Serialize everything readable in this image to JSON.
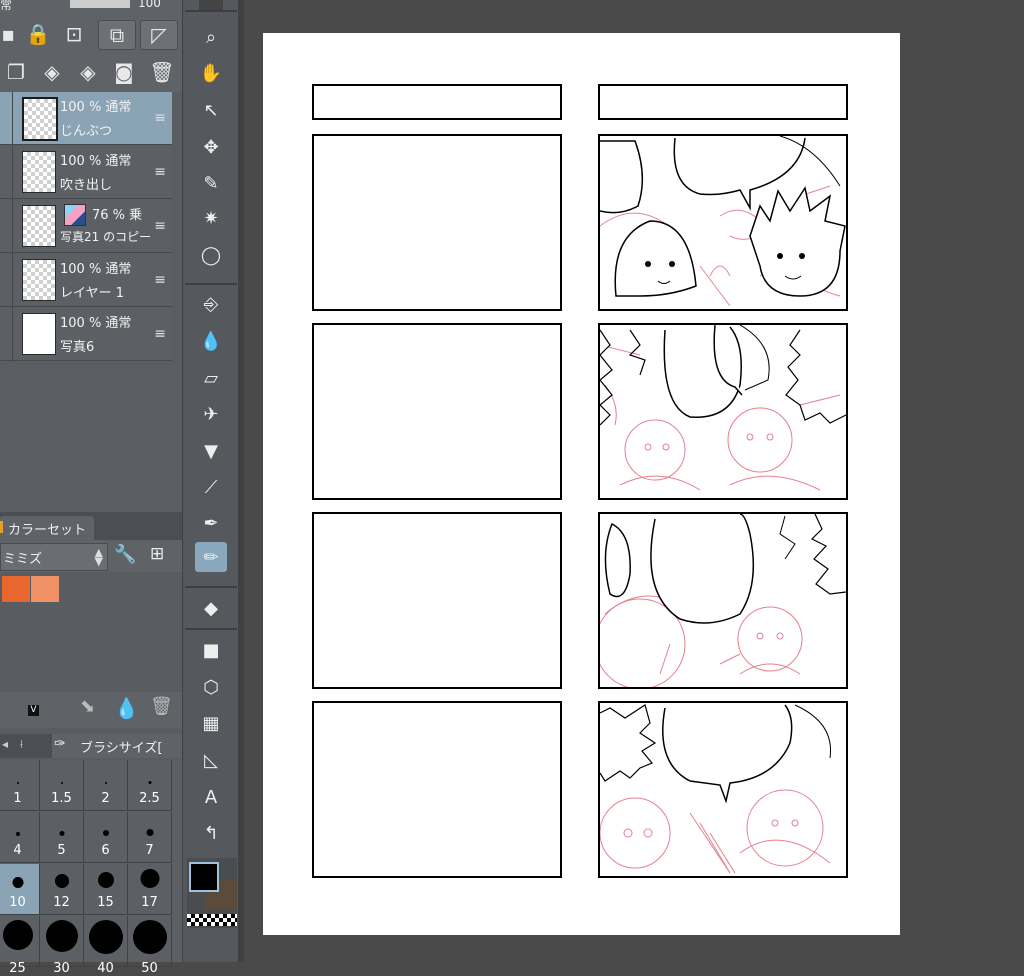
{
  "layer_panel": {
    "layers": [
      {
        "opacity_blend": "100 % 通常",
        "name": "じんぶつ",
        "selected": true,
        "thumb": "transparent"
      },
      {
        "opacity_blend": "100 % 通常",
        "name": "吹き出し",
        "selected": false,
        "thumb": "transparent"
      },
      {
        "opacity_blend": "76 % 乗",
        "name": "写真21 のコピー",
        "selected": false,
        "thumb": "transparent"
      },
      {
        "opacity_blend": "100 % 通常",
        "name": "レイヤー 1",
        "selected": false,
        "thumb": "transparent"
      },
      {
        "opacity_blend": "100 % 通常",
        "name": "写真6",
        "selected": false,
        "thumb": "white"
      }
    ],
    "top_partial_label": "常",
    "top_partial_value": "100"
  },
  "color_set": {
    "tab_label": "カラーセット",
    "set_name": "ミミズ",
    "swatches": [
      "#e8672f",
      "#ef9165"
    ],
    "badge": "V"
  },
  "brush_size": {
    "tab_label": "ブラシサイズ[",
    "sizes": [
      {
        "label": "1",
        "dot": 2
      },
      {
        "label": "1.5",
        "dot": 2
      },
      {
        "label": "2",
        "dot": 2
      },
      {
        "label": "2.5",
        "dot": 3
      },
      {
        "label": "4",
        "dot": 4
      },
      {
        "label": "5",
        "dot": 5
      },
      {
        "label": "6",
        "dot": 6
      },
      {
        "label": "7",
        "dot": 7
      },
      {
        "label": "10",
        "dot": 11,
        "selected": true
      },
      {
        "label": "12",
        "dot": 14
      },
      {
        "label": "15",
        "dot": 16
      },
      {
        "label": "17",
        "dot": 19
      },
      {
        "label": "25",
        "dot": 30
      },
      {
        "label": "30",
        "dot": 32
      },
      {
        "label": "40",
        "dot": 34
      },
      {
        "label": "50",
        "dot": 34
      }
    ]
  },
  "tools": [
    {
      "name": "zoom-tool",
      "glyph": "⌕"
    },
    {
      "name": "hand-tool",
      "glyph": "✋"
    },
    {
      "name": "operation-tool",
      "glyph": "↖"
    },
    {
      "name": "move-layer-tool",
      "glyph": "✥"
    },
    {
      "name": "selection-pen-tool",
      "glyph": "✎"
    },
    {
      "name": "auto-select-tool",
      "glyph": "✷"
    },
    {
      "name": "lasso-tool",
      "glyph": "◯"
    },
    {
      "name": "eyedropper-tool",
      "glyph": "⎆"
    },
    {
      "name": "blend-tool",
      "glyph": "💧"
    },
    {
      "name": "eraser-tool",
      "glyph": "▱"
    },
    {
      "name": "airbrush-tool",
      "glyph": "✈"
    },
    {
      "name": "marker-tool",
      "glyph": "▼"
    },
    {
      "name": "brush-tool",
      "glyph": "⟋"
    },
    {
      "name": "pen-tool",
      "glyph": "✒"
    },
    {
      "name": "pencil-tool",
      "glyph": "✏",
      "active": true
    },
    {
      "name": "fill-tool",
      "glyph": "◆"
    },
    {
      "name": "gradient-tool",
      "glyph": "■"
    },
    {
      "name": "figure-tool",
      "glyph": "⬡"
    },
    {
      "name": "frame-border-tool",
      "glyph": "▦"
    },
    {
      "name": "ruler-tool",
      "glyph": "◺"
    },
    {
      "name": "text-tool",
      "glyph": "A"
    },
    {
      "name": "balloon-tool",
      "glyph": "↰"
    }
  ],
  "colors": {
    "main": "#000000",
    "sub": "#5c4a3a",
    "sketch": "#e06a7a",
    "selected_layer": "#8aa3b5"
  }
}
